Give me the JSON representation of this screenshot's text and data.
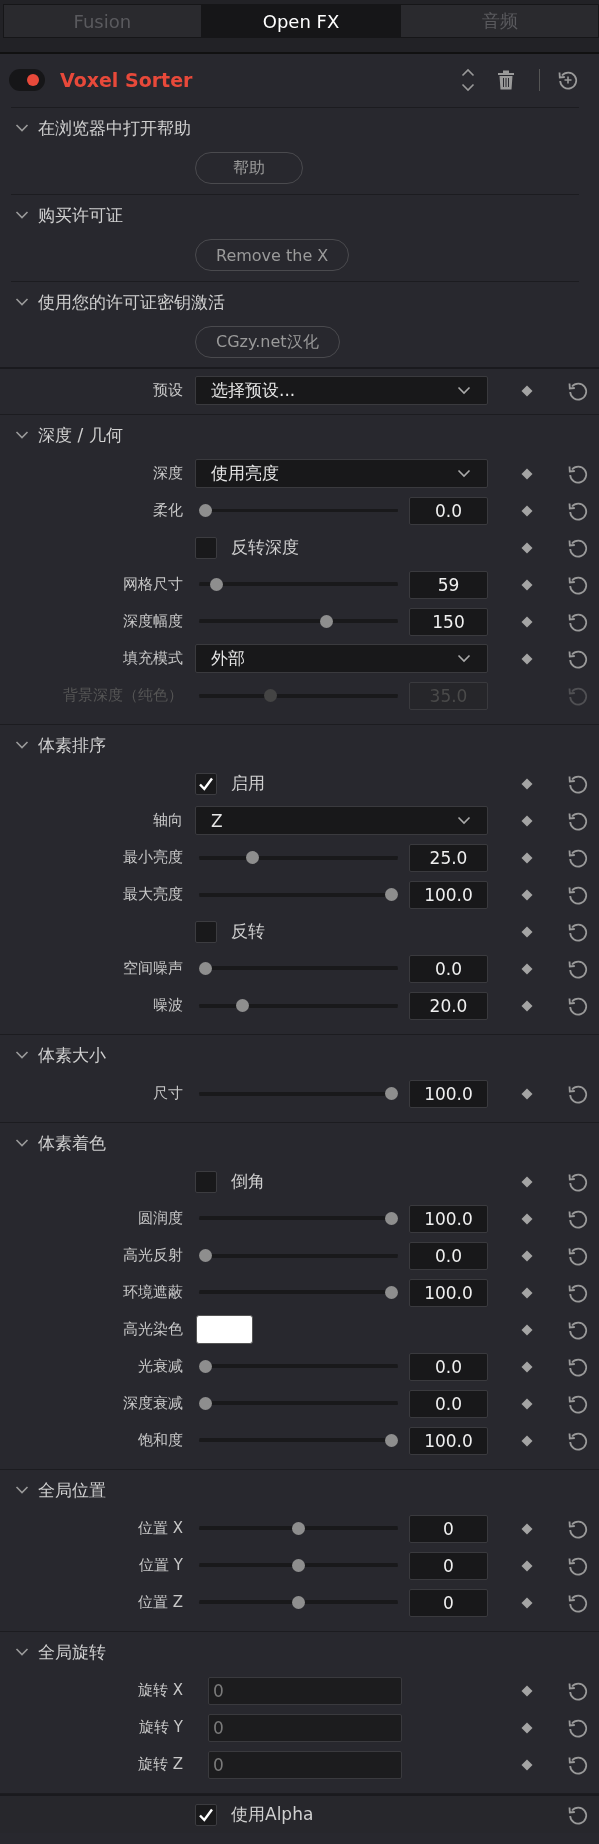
{
  "tabs": [
    {
      "label": "Fusion",
      "selected": false
    },
    {
      "label": "Open FX",
      "selected": true
    },
    {
      "label": "音频",
      "selected": false
    }
  ],
  "effect": {
    "title": "Voxel Sorter",
    "enabled": true
  },
  "help_sections": [
    {
      "title": "在浏览器中打开帮助",
      "expanded": true,
      "button": "帮助"
    },
    {
      "title": "购买许可证",
      "expanded": true,
      "button": "Remove the X"
    },
    {
      "title": "使用您的许可证密钥激活",
      "expanded": true,
      "button": "CGzy.net汉化"
    }
  ],
  "preset": {
    "kind": "dropdown",
    "label": "预设",
    "value": "选择预设...",
    "keyframe": true,
    "disabled": false
  },
  "sections": [
    {
      "title": "深度 / 几何",
      "expanded": true,
      "rows": [
        {
          "kind": "dropdown",
          "label": "深度",
          "value": "使用亮度",
          "keyframe": true,
          "disabled": false
        },
        {
          "kind": "slider",
          "label": "柔化",
          "value": "0.0",
          "level": 0,
          "keyframe": true,
          "disabled": false
        },
        {
          "kind": "checkbox",
          "label": "反转深度",
          "checked": false,
          "keyframe": true,
          "disabled": false
        },
        {
          "kind": "slider",
          "label": "网格尺寸",
          "value": "59",
          "level": 0.06,
          "keyframe": true,
          "disabled": false
        },
        {
          "kind": "slider",
          "label": "深度幅度",
          "value": "150",
          "level": 0.65,
          "keyframe": true,
          "disabled": false
        },
        {
          "kind": "dropdown",
          "label": "填充模式",
          "value": "外部",
          "keyframe": true,
          "disabled": false
        },
        {
          "kind": "slider",
          "label": "背景深度（纯色）",
          "value": "35.0",
          "level": 0.35,
          "keyframe": false,
          "disabled": true
        }
      ]
    },
    {
      "title": "体素排序",
      "expanded": true,
      "rows": [
        {
          "kind": "checkbox",
          "label": "启用",
          "checked": true,
          "keyframe": true,
          "disabled": false
        },
        {
          "kind": "dropdown",
          "label": "轴向",
          "value": "Z",
          "keyframe": true,
          "disabled": false
        },
        {
          "kind": "slider",
          "label": "最小亮度",
          "value": "25.0",
          "level": 0.25,
          "keyframe": true,
          "disabled": false
        },
        {
          "kind": "slider",
          "label": "最大亮度",
          "value": "100.0",
          "level": 1,
          "keyframe": true,
          "disabled": false
        },
        {
          "kind": "checkbox",
          "label": "反转",
          "checked": false,
          "keyframe": true,
          "disabled": false
        },
        {
          "kind": "slider",
          "label": "空间噪声",
          "value": "0.0",
          "level": 0,
          "keyframe": true,
          "disabled": false
        },
        {
          "kind": "slider",
          "label": "噪波",
          "value": "20.0",
          "level": 0.2,
          "keyframe": true,
          "disabled": false
        }
      ]
    },
    {
      "title": "体素大小",
      "expanded": true,
      "rows": [
        {
          "kind": "slider",
          "label": "尺寸",
          "value": "100.0",
          "level": 1,
          "keyframe": true,
          "disabled": false
        }
      ]
    },
    {
      "title": "体素着色",
      "expanded": true,
      "rows": [
        {
          "kind": "checkbox",
          "label": "倒角",
          "checked": false,
          "keyframe": true,
          "disabled": false
        },
        {
          "kind": "slider",
          "label": "圆润度",
          "value": "100.0",
          "level": 1,
          "keyframe": true,
          "disabled": false
        },
        {
          "kind": "slider",
          "label": "高光反射",
          "value": "0.0",
          "level": 0,
          "keyframe": true,
          "disabled": false
        },
        {
          "kind": "slider",
          "label": "环境遮蔽",
          "value": "100.0",
          "level": 1,
          "keyframe": true,
          "disabled": false
        },
        {
          "kind": "color",
          "label": "高光染色",
          "color": "#ffffff",
          "keyframe": true,
          "disabled": false
        },
        {
          "kind": "slider",
          "label": "光衰减",
          "value": "0.0",
          "level": 0,
          "keyframe": true,
          "disabled": false
        },
        {
          "kind": "slider",
          "label": "深度衰减",
          "value": "0.0",
          "level": 0,
          "keyframe": true,
          "disabled": false
        },
        {
          "kind": "slider",
          "label": "饱和度",
          "value": "100.0",
          "level": 1,
          "keyframe": true,
          "disabled": false
        }
      ]
    },
    {
      "title": "全局位置",
      "expanded": true,
      "rows": [
        {
          "kind": "slider",
          "label": "位置 X",
          "value": "0",
          "level": 0.5,
          "keyframe": true,
          "disabled": false
        },
        {
          "kind": "slider",
          "label": "位置 Y",
          "value": "0",
          "level": 0.5,
          "keyframe": true,
          "disabled": false
        },
        {
          "kind": "slider",
          "label": "位置 Z",
          "value": "0",
          "level": 0.5,
          "keyframe": true,
          "disabled": false
        }
      ]
    },
    {
      "title": "全局旋转",
      "expanded": true,
      "rows": [
        {
          "kind": "number_field",
          "label": "旋转 X",
          "value": "0",
          "keyframe": true,
          "disabled": false
        },
        {
          "kind": "number_field",
          "label": "旋转 Y",
          "value": "0",
          "keyframe": true,
          "disabled": false
        },
        {
          "kind": "number_field",
          "label": "旋转 Z",
          "value": "0",
          "keyframe": true,
          "disabled": false
        }
      ]
    }
  ],
  "footer": {
    "kind": "checkbox",
    "label": "使用Alpha",
    "checked": true,
    "keyframe": false,
    "disabled": false
  }
}
